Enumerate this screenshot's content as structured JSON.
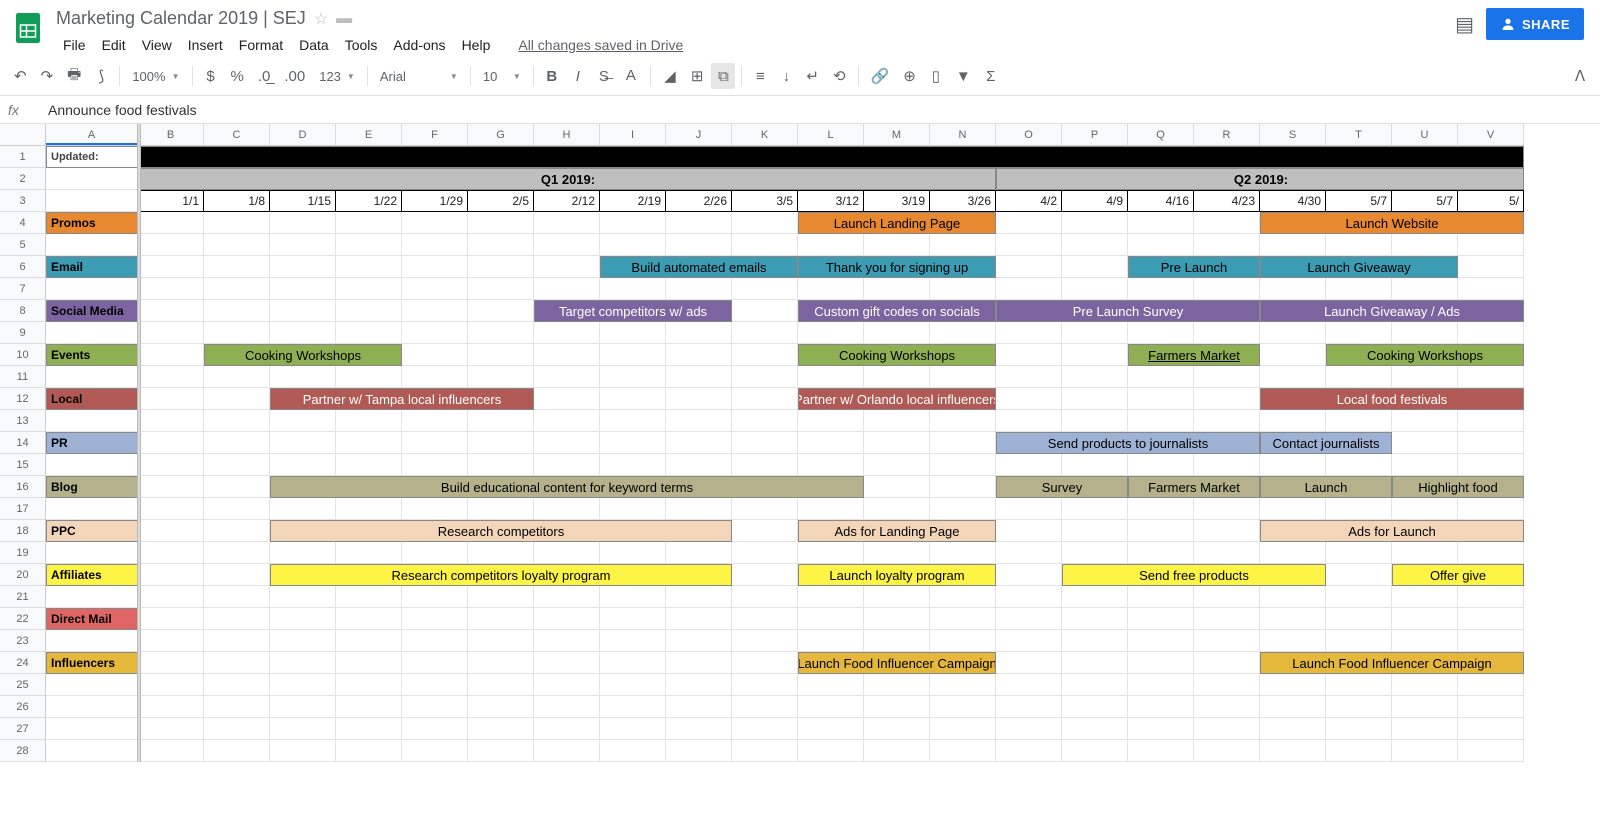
{
  "header": {
    "title": "Marketing Calendar 2019 | SEJ",
    "menu": [
      "File",
      "Edit",
      "View",
      "Insert",
      "Format",
      "Data",
      "Tools",
      "Add-ons",
      "Help"
    ],
    "saved": "All changes saved in Drive",
    "share": "SHARE"
  },
  "toolbar": {
    "zoom": "100%",
    "font": "Arial",
    "size": "10",
    "format_number": "123"
  },
  "formula": "Announce food festivals",
  "columns": [
    "A",
    "B",
    "C",
    "D",
    "E",
    "F",
    "G",
    "H",
    "I",
    "J",
    "K",
    "L",
    "M",
    "N",
    "O",
    "P",
    "Q",
    "R",
    "S",
    "T",
    "U",
    "V"
  ],
  "rows": {
    "updated": "Updated:",
    "q1": "Q1 2019:",
    "q2": "Q2 2019:",
    "dates": [
      "1/1",
      "1/8",
      "1/15",
      "1/22",
      "1/29",
      "2/5",
      "2/12",
      "2/19",
      "2/26",
      "3/5",
      "3/12",
      "3/19",
      "3/26",
      "4/2",
      "4/9",
      "4/16",
      "4/23",
      "4/30",
      "5/7",
      "5/7",
      "5/"
    ]
  },
  "categories": {
    "promos": "Promos",
    "email": "Email",
    "social": "Social Media",
    "events": "Events",
    "local": "Local",
    "pr": "PR",
    "blog": "Blog",
    "ppc": "PPC",
    "affiliates": "Affiliates",
    "direct": "Direct Mail",
    "influencers": "Influencers"
  },
  "blocks": {
    "promos1": "Launch Landing Page",
    "promos2": "Launch Website",
    "email1": "Build automated emails",
    "email2": "Thank you for signing up",
    "email3": "Pre Launch",
    "email4": "Launch Giveaway",
    "social1": "Target competitors w/ ads",
    "social2": "Custom gift codes on socials",
    "social3": "Pre Launch Survey",
    "social4": "Launch Giveaway / Ads",
    "events1": "Cooking Workshops",
    "events2": "Cooking Workshops",
    "events3": "Farmers Market",
    "events4": "Cooking Workshops",
    "local1": "Partner w/ Tampa local influencers",
    "local2": "Partner w/ Orlando local influencers",
    "local3": "Local food festivals",
    "pr1": "Send products to journalists",
    "pr2": "Contact journalists",
    "blog1": "Build educational content for keyword terms",
    "blog2": "Survey",
    "blog3": "Farmers Market",
    "blog4": "Launch",
    "blog5": "Highlight food",
    "ppc1": "Research competitors",
    "ppc2": "Ads for Landing Page",
    "ppc3": "Ads for Launch",
    "aff1": "Research competitors loyalty program",
    "aff2": "Launch loyalty program",
    "aff3": "Send free products",
    "aff4": "Offer give",
    "inf1": "Launch Food Influencer Campaign",
    "inf2": "Launch Food Influencer Campaign"
  },
  "colors": {
    "promos": "#e8882f",
    "email": "#3b9cb4",
    "social": "#7b649f",
    "events": "#8fb052",
    "local": "#b15a55",
    "pr": "#9db2d4",
    "blog": "#b5b18a",
    "ppc": "#f3d6b9",
    "affiliates": "#fef445",
    "direct": "#e06666",
    "influencers": "#e5b73b"
  }
}
